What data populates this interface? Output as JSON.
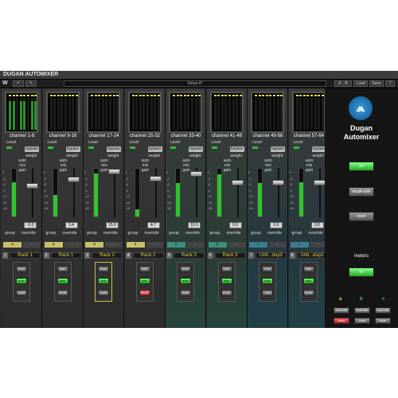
{
  "app": {
    "title": "DUGAN AUTOMIXER",
    "setup": "Setup A*"
  },
  "toolbar": {
    "logo": "W",
    "undo": "↶",
    "redo": "↷",
    "compare": "A→B",
    "load": "Load",
    "save": "Save",
    "help": "?"
  },
  "right": {
    "brand1": "Dugan",
    "brand2": "Automixer",
    "on": "on",
    "recall_safe": "recall-safe",
    "reset": "reset",
    "meters": "meters",
    "meters_on": "on",
    "a": "a",
    "b": "b",
    "c": "c",
    "override": "override",
    "mute": "mute"
  },
  "labels": {
    "level": "Level",
    "bypass": "bypass",
    "weight": "weight",
    "auto": "auto",
    "mix_gain": "mix gain",
    "group": "group",
    "override": "override",
    "auto_btn": "auto",
    "man": "man",
    "mute": "mute"
  },
  "scale": [
    "0",
    "-3",
    "-6",
    "-9",
    "-12",
    "-15",
    "-18"
  ],
  "strips": [
    {
      "channel": "channel 1-8",
      "gain": "-5.0",
      "group": "a",
      "rack_num": "1",
      "rack": "Rack 1",
      "level_fill": 0.72,
      "knob": 0.35,
      "bg": "n",
      "meter_on": true,
      "sel": false,
      "mute_red": false
    },
    {
      "channel": "channel 9-16",
      "gain": "3.4",
      "group": "a",
      "rack_num": "2",
      "rack": "Rack 1",
      "level_fill": 0.45,
      "knob": 0.2,
      "bg": "n",
      "meter_on": false,
      "sel": false,
      "mute_red": false
    },
    {
      "channel": "channel 17-24",
      "gain": "15.0",
      "group": "a",
      "rack_num": "3",
      "rack": "Rack 2",
      "level_fill": 0.9,
      "knob": 0.02,
      "bg": "n",
      "meter_on": false,
      "sel": true,
      "mute_red": false
    },
    {
      "channel": "channel 25-32",
      "gain": "4.7",
      "group": "a",
      "rack_num": "4",
      "rack": "Rack 2",
      "level_fill": 0.15,
      "knob": 0.18,
      "bg": "n",
      "meter_on": false,
      "sel": false,
      "mute_red": true
    },
    {
      "channel": "channel 33-40",
      "gain": "10.5",
      "group": "b",
      "rack_num": "5",
      "rack": "Rack 3",
      "level_fill": 0.7,
      "knob": 0.08,
      "bg": "g",
      "meter_on": false,
      "sel": false,
      "mute_red": false
    },
    {
      "channel": "channel 41-48",
      "gain": "0.0",
      "group": "b",
      "rack_num": "6",
      "rack": "Rack 3",
      "level_fill": 0.88,
      "knob": 0.28,
      "bg": "g",
      "meter_on": false,
      "sel": false,
      "mute_red": false
    },
    {
      "channel": "channel 49-56",
      "gain": "0.0",
      "group": "c",
      "rack_num": "7",
      "rack": "Unti...dup3",
      "level_fill": 0.7,
      "knob": 0.28,
      "bg": "b",
      "meter_on": false,
      "sel": false,
      "mute_red": false
    },
    {
      "channel": "channel 57-64",
      "gain": "0.0",
      "group": "c",
      "rack_num": "8",
      "rack": "Unti...dup3",
      "level_fill": 0.72,
      "knob": 0.28,
      "bg": "b",
      "meter_on": false,
      "sel": false,
      "mute_red": false
    }
  ]
}
